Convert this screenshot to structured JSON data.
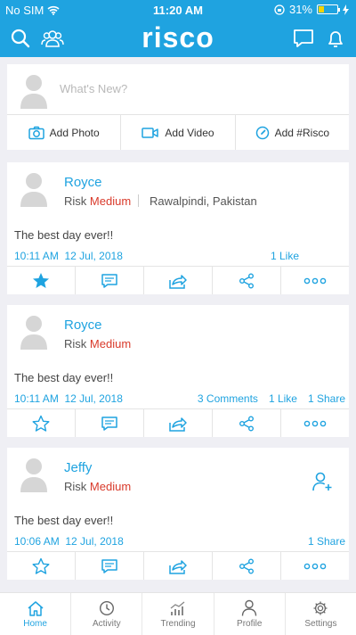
{
  "status": {
    "carrier": "No SIM",
    "time": "11:20 AM",
    "battery": "31%",
    "battery_level": 0.31
  },
  "header": {
    "logo": "risco"
  },
  "compose": {
    "placeholder": "What's New?",
    "actions": [
      {
        "label": "Add Photo",
        "icon": "camera-icon"
      },
      {
        "label": "Add Video",
        "icon": "video-camera-icon"
      },
      {
        "label": "Add #Risco",
        "icon": "compass-icon"
      }
    ]
  },
  "posts": [
    {
      "name": "Royce",
      "risk_label": "Risk",
      "risk_level": "Medium",
      "location": "Rawalpindi, Pakistan",
      "text": "The best day ever!!",
      "time": "10:11 AM",
      "date": "12 Jul, 2018",
      "comments": "",
      "likes": "1 Like",
      "shares": "",
      "starred": true
    },
    {
      "name": "Royce",
      "risk_label": "Risk",
      "risk_level": "Medium",
      "location": "",
      "text": "The best day ever!!",
      "time": "10:11 AM",
      "date": "12 Jul, 2018",
      "comments": "3 Comments",
      "likes": "1 Like",
      "shares": "1 Share",
      "starred": false
    },
    {
      "name": "Jeffy",
      "risk_label": "Risk",
      "risk_level": "Medium",
      "location": "",
      "text": "The best day ever!!",
      "time": "10:06 AM",
      "date": "12 Jul, 2018",
      "comments": "",
      "likes": "",
      "shares": "1 Share",
      "starred": false
    }
  ],
  "tabs": [
    {
      "label": "Home",
      "icon": "home-icon"
    },
    {
      "label": "Activity",
      "icon": "clock-icon"
    },
    {
      "label": "Trending",
      "icon": "trending-chart-icon"
    },
    {
      "label": "Profile",
      "icon": "person-icon"
    },
    {
      "label": "Settings",
      "icon": "gear-icon"
    }
  ],
  "colors": {
    "accent": "#1fa3e0",
    "risk": "#d93a2b"
  }
}
